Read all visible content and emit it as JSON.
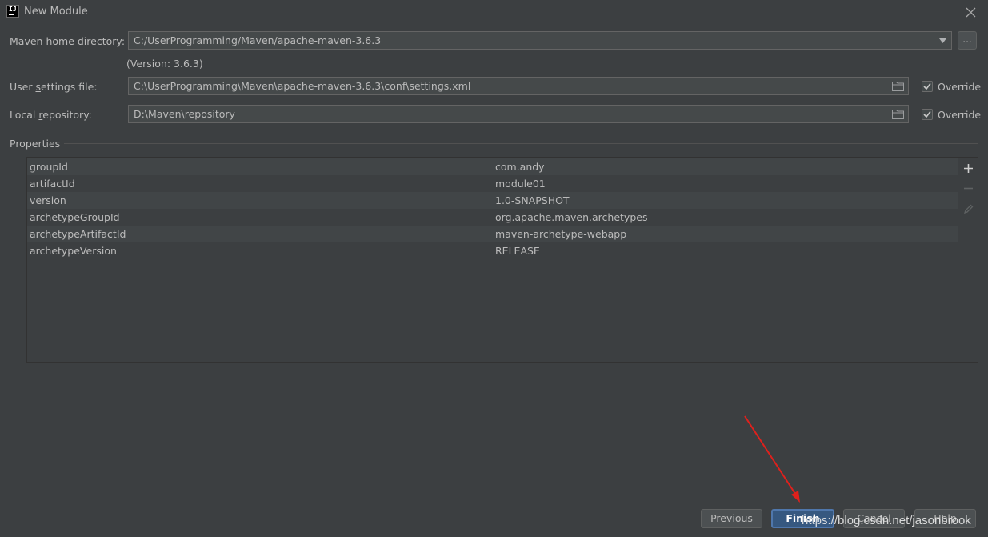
{
  "window": {
    "title": "New Module",
    "icon_text": "IJ"
  },
  "form": {
    "maven_home": {
      "label_pre": "Maven ",
      "label_mn": "h",
      "label_post": "ome directory:",
      "value": "C:/UserProgramming/Maven/apache-maven-3.6.3",
      "browse_label": "..."
    },
    "version_note": "(Version: 3.6.3)",
    "user_settings": {
      "label_pre": "User ",
      "label_mn": "s",
      "label_post": "ettings file:",
      "value": "C:\\UserProgramming\\Maven\\apache-maven-3.6.3\\conf\\settings.xml",
      "override_label": "Override",
      "override_checked": true
    },
    "local_repo": {
      "label_pre": "Local ",
      "label_mn": "r",
      "label_post": "epository:",
      "value": "D:\\Maven\\repository",
      "override_label": "Override",
      "override_checked": true
    }
  },
  "properties": {
    "title": "Properties",
    "rows": [
      {
        "key": "groupId",
        "value": "com.andy"
      },
      {
        "key": "artifactId",
        "value": "module01"
      },
      {
        "key": "version",
        "value": "1.0-SNAPSHOT"
      },
      {
        "key": "archetypeGroupId",
        "value": "org.apache.maven.archetypes"
      },
      {
        "key": "archetypeArtifactId",
        "value": "maven-archetype-webapp"
      },
      {
        "key": "archetypeVersion",
        "value": "RELEASE"
      }
    ]
  },
  "buttons": {
    "previous": {
      "pre": "",
      "mn": "P",
      "post": "revious"
    },
    "finish": {
      "pre": "",
      "mn": "F",
      "post": "inish"
    },
    "cancel": "Cancel",
    "help": "Help"
  },
  "watermark": "https://blog.csdn.net/jasonbrook",
  "colors": {
    "background": "#3c3f41",
    "field": "#45494a",
    "default_button": "#365880",
    "annotation_arrow": "#e0201c"
  }
}
